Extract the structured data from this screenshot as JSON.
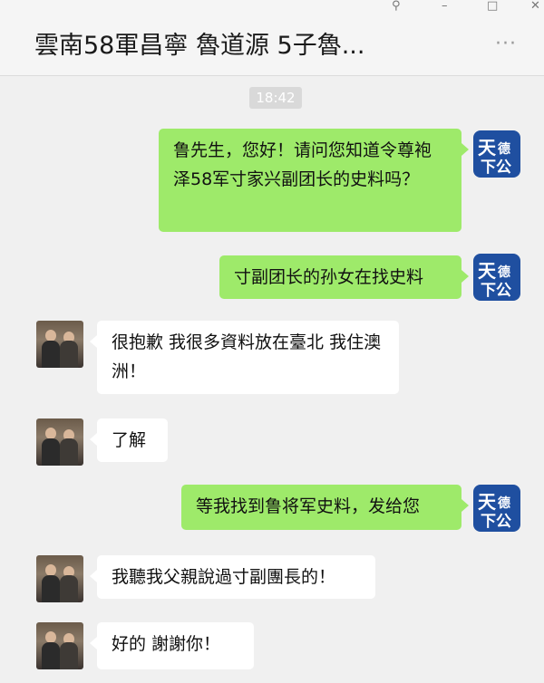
{
  "window": {
    "pin": "⚲",
    "minimize": "–",
    "maximize": "□",
    "close": "✕"
  },
  "chat": {
    "title": "雲南58軍昌寧 魯道源 5子魯...",
    "more": "···"
  },
  "timestamp": "18:42",
  "avatar_me": {
    "top": "天",
    "mid": "德",
    "bottom": "下公"
  },
  "messages": [
    {
      "from": "me",
      "text": "鲁先生，您好！请问您知道令尊袍泽58军寸家兴副团长的史料吗？"
    },
    {
      "from": "me",
      "text": "寸副团长的孙女在找史料"
    },
    {
      "from": "them",
      "text": "很抱歉 我很多資料放在臺北 我住澳洲！"
    },
    {
      "from": "them",
      "text": "了解"
    },
    {
      "from": "me",
      "text": "等我找到鲁将军史料，发给您"
    },
    {
      "from": "them",
      "text": "我聽我父親說過寸副團長的！"
    },
    {
      "from": "them",
      "text": "好的 謝謝你！"
    }
  ]
}
